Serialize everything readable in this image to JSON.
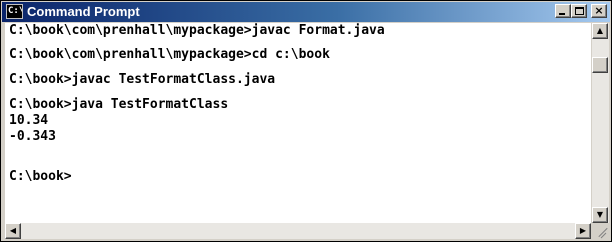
{
  "window": {
    "title": "Command Prompt",
    "icon": "command-prompt-icon",
    "icon_text": "C:\\"
  },
  "controls": {
    "minimize": "minimize-icon",
    "maximize": "maximize-icon",
    "close": "close-icon"
  },
  "console": {
    "lines": [
      "C:\\book\\com\\prenhall\\mypackage>javac Format.java",
      "C:\\book\\com\\prenhall\\mypackage>cd c:\\book",
      "C:\\book>javac TestFormatClass.java",
      "C:\\book>java TestFormatClass",
      "10.34",
      "-0.343",
      "C:\\book>"
    ]
  },
  "colors": {
    "titlebar_start": "#0a246a",
    "titlebar_end": "#a6caf0",
    "console_background": "#ffffff",
    "console_text": "#000000",
    "chrome": "#d4d0c8"
  }
}
